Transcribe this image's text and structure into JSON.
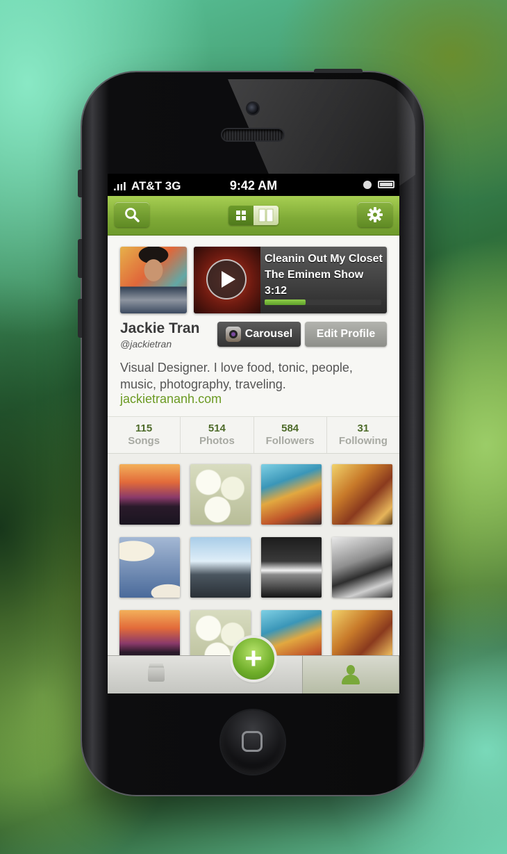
{
  "status_bar": {
    "signal": ".ııl",
    "carrier": "AT&T 3G",
    "time": "9:42 AM"
  },
  "nav": {
    "search_icon": "search-icon",
    "settings_icon": "gear-icon",
    "view_toggle": [
      "grid-view",
      "list-view"
    ],
    "active_view": "list-view"
  },
  "player": {
    "song": "Cleanin Out My Closet",
    "album": "The Eminem Show",
    "duration": "3:12",
    "progress": 0.35
  },
  "profile": {
    "name": "Jackie Tran",
    "handle": "@jackietran",
    "carousel_label": "Carousel",
    "edit_label": "Edit Profile",
    "bio": "Visual Designer. I love food, tonic, people, music, photography, traveling.",
    "website": "jackietrananh.com"
  },
  "stats": [
    {
      "num": "115",
      "label": "Songs"
    },
    {
      "num": "514",
      "label": "Photos"
    },
    {
      "num": "584",
      "label": "Followers"
    },
    {
      "num": "31",
      "label": "Following"
    }
  ],
  "tabbar": {
    "add_label": "+",
    "tabs": [
      "stack-icon",
      "add-icon",
      "profile-icon"
    ],
    "active_tab": "profile-icon"
  },
  "colors": {
    "accent": "#7ea936",
    "link": "#6b9a23"
  }
}
